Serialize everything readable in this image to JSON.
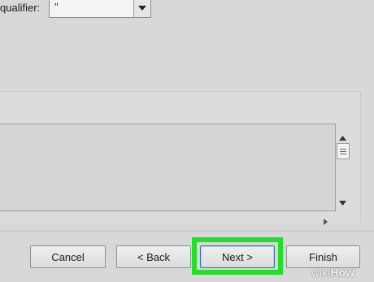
{
  "wizard": {
    "text_qualifier_label": "qualifier:",
    "text_qualifier_value": "\"",
    "buttons": {
      "cancel": "Cancel",
      "back": "< Back",
      "next": "Next >",
      "finish": "Finish"
    }
  },
  "icons": {
    "dropdown": "chevron-down-icon",
    "scroll_up": "triangle-up-icon",
    "scroll_down": "triangle-down-icon",
    "scroll_right": "triangle-right-icon",
    "scroll_grip": "grip-lines-icon"
  },
  "colors": {
    "highlight": "#22e028",
    "background": "#d8d8d8"
  },
  "watermark": {
    "prefix": "wiki",
    "suffix": "How"
  }
}
